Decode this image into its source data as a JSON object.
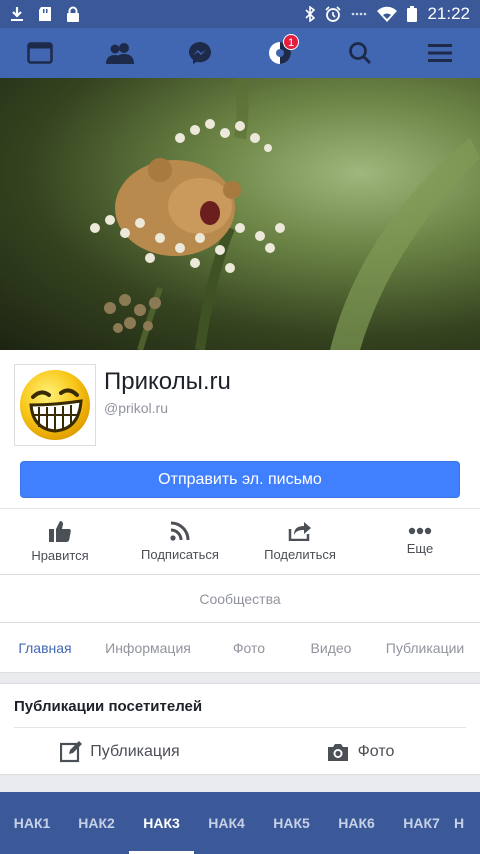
{
  "status_bar": {
    "time": "21:22",
    "icons_left": [
      "download-icon",
      "sd-card-icon",
      "lock-icon"
    ],
    "icons_right": [
      "bluetooth-icon",
      "alarm-icon",
      "dots-icon",
      "wifi-icon",
      "battery-icon"
    ]
  },
  "nav": {
    "items": [
      "feed-icon",
      "friends-icon",
      "messenger-icon",
      "notifications-icon",
      "search-icon",
      "menu-icon"
    ],
    "notification_count": "1"
  },
  "profile": {
    "name": "Приколы.ru",
    "handle": "@prikol.ru",
    "email_button": "Отправить эл. письмо"
  },
  "actions": [
    {
      "label": "Нравится",
      "icon": "like-icon"
    },
    {
      "label": "Подписаться",
      "icon": "rss-icon"
    },
    {
      "label": "Поделиться",
      "icon": "share-icon"
    },
    {
      "label": "Еще",
      "icon": "more-icon"
    }
  ],
  "communities": "Сообщества",
  "tabs": [
    "Главная",
    "Информация",
    "Фото",
    "Видео",
    "Публикации"
  ],
  "active_tab": "Главная",
  "visitors": {
    "title": "Публикации посетителей",
    "post_label": "Публикация",
    "photo_label": "Фото"
  },
  "bottom_bar": [
    "НАК1",
    "НАК2",
    "НАК3",
    "НАК4",
    "НАК5",
    "НАК6",
    "НАК7",
    "Н"
  ],
  "active_bottom": "НАК3",
  "colors": {
    "brand": "#3b5998",
    "nav": "#4267b2",
    "button": "#4080ff",
    "badge": "#e41e3f"
  }
}
